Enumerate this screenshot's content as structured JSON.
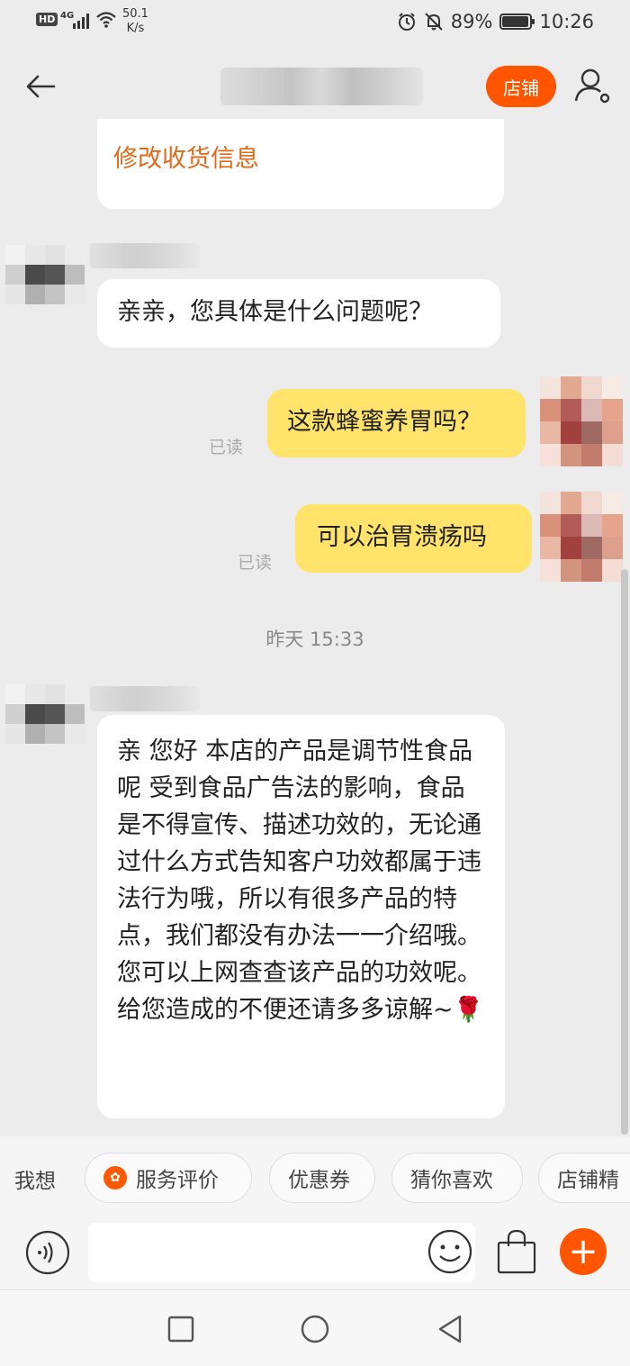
{
  "status_bar": {
    "hd": "HD",
    "network": "4G",
    "speed_value": "50.1",
    "speed_unit": "K/s",
    "battery": "89%",
    "time": "10:26",
    "battery_level": 0.89
  },
  "header": {
    "shop_label": "店铺"
  },
  "messages": {
    "modify_shipping": "修改收货信息",
    "seller_question": "亲亲，您具体是什么问题呢？",
    "user_msg_1": "这款蜂蜜养胃吗？",
    "user_msg_1_status": "已读",
    "user_msg_2": "可以治胃溃疡吗",
    "user_msg_2_status": "已读",
    "timestamp": "昨天  15:33",
    "seller_reply": "亲 您好  本店的产品是调节性食品呢  受到食品广告法的影响，食品是不得宣传、描述功效的，无论通过什么方式告知客户功效都属于违法行为哦，所以有很多产品的特点，我们都没有办法一一介绍哦。您可以上网查查该产品的功效呢。给您造成的不便还请多多谅解~🌹"
  },
  "quick_bar": {
    "label": "我想",
    "chips": [
      "服务评价",
      "优惠券",
      "猜你喜欢",
      "店铺精"
    ]
  },
  "input_bar": {
    "placeholder": ""
  },
  "colors": {
    "accent": "#ff5400",
    "user_bubble": "#ffe36b",
    "link": "#e06a1b"
  }
}
